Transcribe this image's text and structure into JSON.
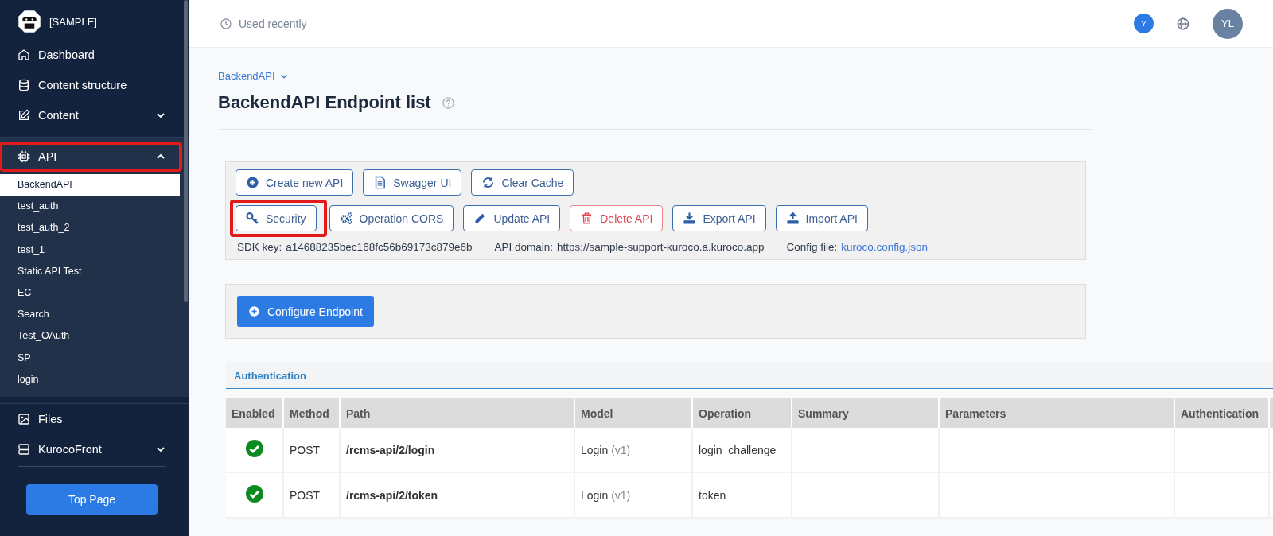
{
  "sidebar": {
    "site": "[SAMPLE]",
    "items": [
      {
        "label": "Dashboard",
        "highlighted": false
      },
      {
        "label": "Content structure",
        "highlighted": false
      },
      {
        "label": "Content",
        "expanded": false,
        "highlighted": false
      },
      {
        "label": "API",
        "expanded": true,
        "highlighted": true,
        "children": [
          {
            "label": "BackendAPI",
            "selected": true
          },
          {
            "label": "test_auth",
            "selected": false
          },
          {
            "label": "test_auth_2",
            "selected": false
          },
          {
            "label": "test_1",
            "selected": false
          },
          {
            "label": "Static API Test",
            "selected": false
          },
          {
            "label": "EC",
            "selected": false
          },
          {
            "label": "Search",
            "selected": false
          },
          {
            "label": "Test_OAuth",
            "selected": false
          },
          {
            "label": "SP_",
            "selected": false
          },
          {
            "label": "login",
            "selected": false
          }
        ]
      },
      {
        "label": "Files",
        "highlighted": false
      },
      {
        "label": "KurocoFront",
        "expanded": false,
        "highlighted": false
      }
    ],
    "button": "Top Page"
  },
  "topbar": {
    "recent": "Used recently",
    "badge": "Y",
    "avatar": "YL"
  },
  "breadcrumb": "BackendAPI",
  "title": "BackendAPI Endpoint list",
  "actions": [
    {
      "label": "Create new API",
      "kind": "normal",
      "highlighted": false
    },
    {
      "label": "Swagger UI",
      "kind": "normal",
      "highlighted": false
    },
    {
      "label": "Clear Cache",
      "kind": "normal",
      "highlighted": false
    },
    {
      "label": "Security",
      "kind": "normal",
      "highlighted": true
    },
    {
      "label": "Operation CORS",
      "kind": "normal",
      "highlighted": false
    },
    {
      "label": "Update API",
      "kind": "normal",
      "highlighted": false
    },
    {
      "label": "Delete API",
      "kind": "danger",
      "highlighted": false
    },
    {
      "label": "Export API",
      "kind": "normal",
      "highlighted": false
    },
    {
      "label": "Import API",
      "kind": "normal",
      "highlighted": false
    }
  ],
  "info": [
    {
      "label": "SDK key:",
      "value": "a14688235bec168fc56b69173c879e6b",
      "kind": "text"
    },
    {
      "label": "API domain:",
      "value": "https://sample-support-kuroco.a.kuroco.app",
      "kind": "text"
    },
    {
      "label": "Config file:",
      "value": "kuroco.config.json",
      "kind": "link"
    }
  ],
  "configure_button": "Configure Endpoint",
  "section": {
    "title": "Authentication",
    "columns": [
      "Enabled",
      "Method",
      "Path",
      "Model",
      "Operation",
      "Summary",
      "Parameters",
      "Authentication"
    ],
    "rows": [
      {
        "enabled": true,
        "method": "POST",
        "path": "/rcms-api/2/login",
        "model": "Login",
        "version": "(v1)",
        "operation": "login_challenge"
      },
      {
        "enabled": true,
        "method": "POST",
        "path": "/rcms-api/2/token",
        "model": "Login",
        "version": "(v1)",
        "operation": "token"
      }
    ]
  }
}
